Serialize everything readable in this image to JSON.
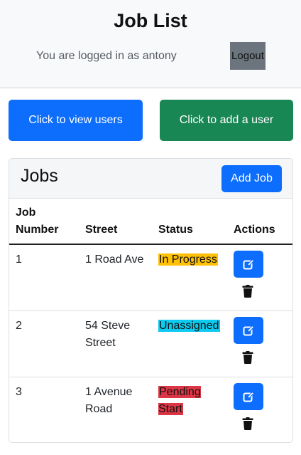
{
  "header": {
    "title": "Job List",
    "login_text": "You are logged in as antony",
    "logout_label": "Logout"
  },
  "actions": {
    "view_users_label": "Click to view users",
    "add_user_label": "Click to add a user"
  },
  "jobs_card": {
    "title": "Jobs",
    "add_job_label": "Add Job",
    "columns": {
      "job_number": "Job Number",
      "street": "Street",
      "status": "Status",
      "actions": "Actions"
    },
    "rows": [
      {
        "job_number": "1",
        "street": "1 Road Ave",
        "status": "In Progress",
        "status_color": "#ffc107"
      },
      {
        "job_number": "2",
        "street": "54 Steve Street",
        "status": "Unassigned",
        "status_color": "#0dcaf0"
      },
      {
        "job_number": "3",
        "street": "1 Avenue Road",
        "status": "Pending Start",
        "status_color": "#dc3545"
      }
    ],
    "icons": {
      "edit": "edit-icon",
      "delete": "trash-icon"
    }
  },
  "colors": {
    "primary": "#0d6efd",
    "success": "#198754",
    "secondary": "#6c757d"
  }
}
